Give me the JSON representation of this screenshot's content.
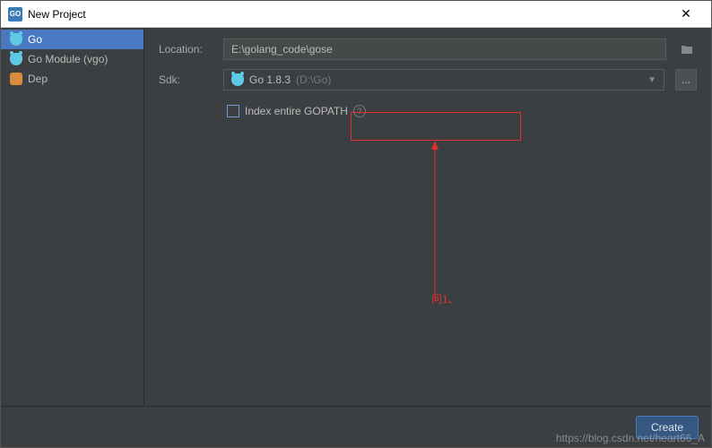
{
  "titlebar": {
    "icon_text": "GO",
    "title": "New Project",
    "close": "✕"
  },
  "sidebar": {
    "items": [
      {
        "label": "Go",
        "icon": "gopher"
      },
      {
        "label": "Go Module (vgo)",
        "icon": "gopher"
      },
      {
        "label": "Dep",
        "icon": "dep"
      }
    ]
  },
  "form": {
    "location_label": "Location:",
    "location_value": "E:\\golang_code\\gose",
    "sdk_label": "Sdk:",
    "sdk_version": "Go 1.8.3",
    "sdk_path": "(D:\\Go)",
    "sdk_more": "...",
    "checkbox_label": "Index entire GOPATH",
    "help_text": "?"
  },
  "annotation": {
    "text": "问1、"
  },
  "footer": {
    "create_label": "Create"
  },
  "watermark": "https://blog.csdn.net/heart66_A"
}
